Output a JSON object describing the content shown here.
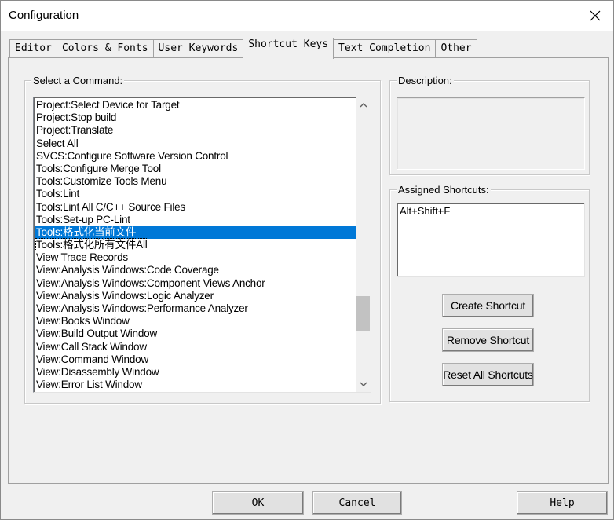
{
  "window": {
    "title": "Configuration",
    "close_glyph": "close-icon"
  },
  "tabs": [
    {
      "label": "Editor",
      "active": false
    },
    {
      "label": "Colors & Fonts",
      "active": false
    },
    {
      "label": "User Keywords",
      "active": false
    },
    {
      "label": "Shortcut Keys",
      "active": true
    },
    {
      "label": "Text Completion",
      "active": false
    },
    {
      "label": "Other",
      "active": false
    }
  ],
  "commands": {
    "group_label": "Select a Command:",
    "selected_index": 10,
    "items": [
      "Project:Select Device for Target",
      "Project:Stop build",
      "Project:Translate",
      "Select All",
      "SVCS:Configure Software Version Control",
      "Tools:Configure Merge Tool",
      "Tools:Customize Tools Menu",
      "Tools:Lint",
      "Tools:Lint All C/C++ Source Files",
      "Tools:Set-up PC-Lint",
      "Tools:格式化当前文件",
      "Tools:格式化所有文件All",
      "View Trace Records",
      "View:Analysis Windows:Code Coverage",
      "View:Analysis Windows:Component Views Anchor",
      "View:Analysis Windows:Logic Analyzer",
      "View:Analysis Windows:Performance Analyzer",
      "View:Books Window",
      "View:Build Output Window",
      "View:Call Stack Window",
      "View:Command Window",
      "View:Disassembly Window",
      "View:Error List Window"
    ]
  },
  "description": {
    "group_label": "Description:",
    "text": ""
  },
  "assigned": {
    "group_label": "Assigned Shortcuts:",
    "items": [
      "Alt+Shift+F"
    ]
  },
  "actions": {
    "create_label": "Create Shortcut",
    "remove_label": "Remove Shortcut",
    "reset_label": "Reset All Shortcuts"
  },
  "footer": {
    "ok_label": "OK",
    "cancel_label": "Cancel",
    "help_label": "Help"
  }
}
